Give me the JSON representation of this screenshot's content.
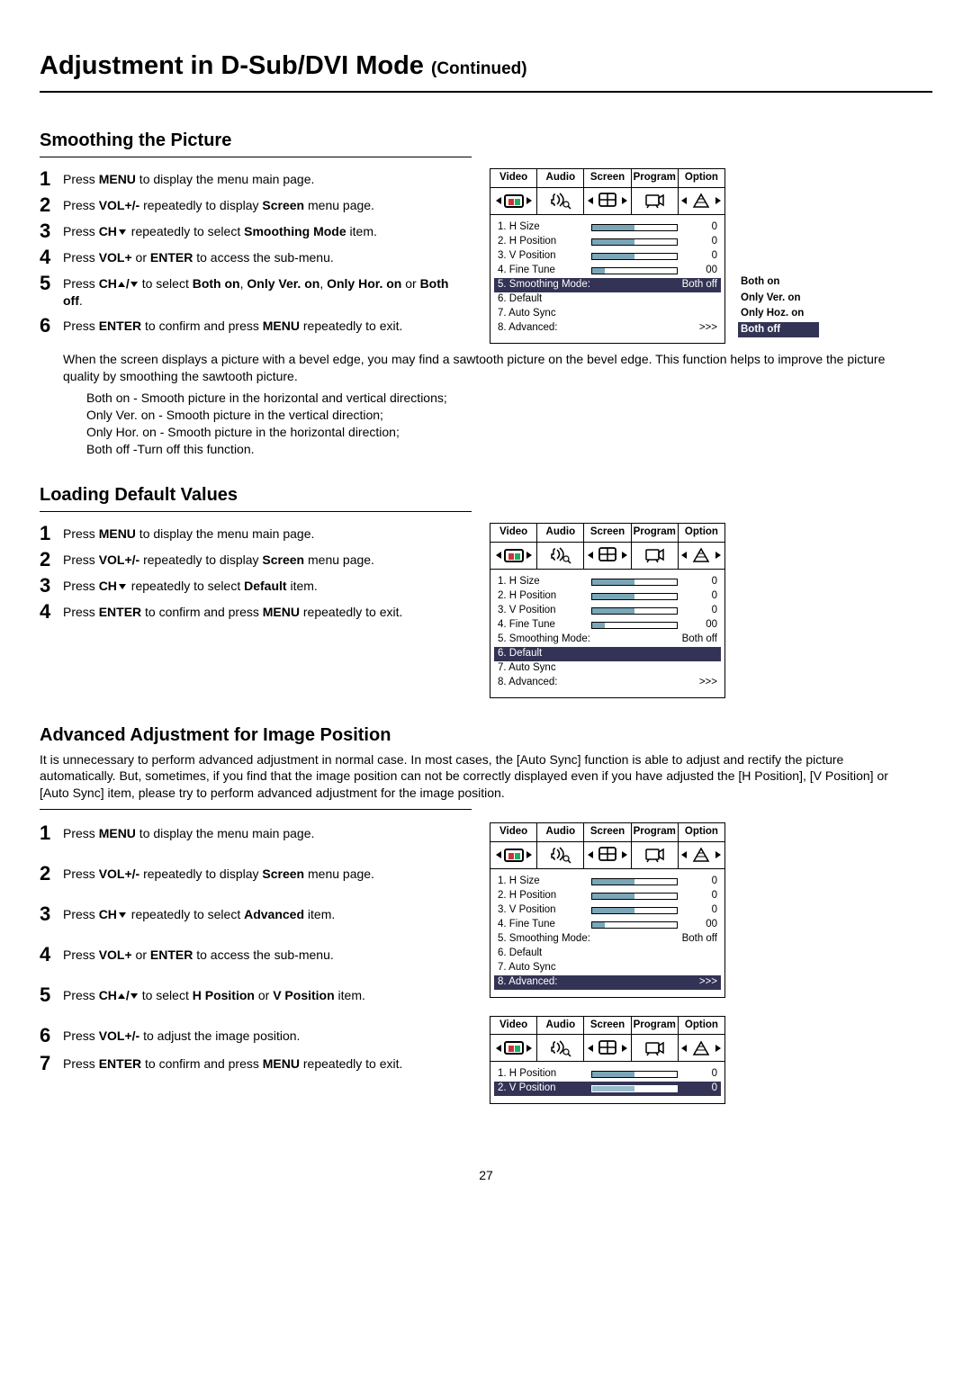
{
  "page": {
    "title": "Adjustment in D-Sub/DVI Mode ",
    "title_sub": "(Continued)",
    "number": "27"
  },
  "sections": {
    "smoothing": {
      "title": "Smoothing the Picture",
      "steps": {
        "s1a": "Press ",
        "s1b": "MENU",
        "s1c": " to display the menu main page.",
        "s2a": "Press ",
        "s2b": "VOL+/-",
        "s2c": " repeatedly to display ",
        "s2d": "Screen",
        "s2e": " menu page.",
        "s3a": "Press ",
        "s3b": "CH",
        "s3c": " repeatedly to select ",
        "s3d": "Smoothing Mode",
        "s3e": " item.",
        "s4a": "Press ",
        "s4b": "VOL+",
        "s4c": " or ",
        "s4d": "ENTER",
        "s4e": " to access the sub-menu.",
        "s5a": "Press ",
        "s5b": "CH",
        "s5c": " to select ",
        "s5d": "Both on",
        "s5e": ", ",
        "s5f": "Only Ver. on",
        "s5g": ", ",
        "s5h": "Only Hor. on",
        "s5i": " or ",
        "s5j": "Both off",
        "s5k": ".",
        "s6a": "Press ",
        "s6b": "ENTER",
        "s6c": " to confirm and press ",
        "s6d": "MENU",
        "s6e": " repeatedly to exit."
      },
      "explain1": "When the screen displays a picture with a bevel edge, you may find a sawtooth picture on the bevel edge. This function helps to improve the picture quality by smoothing the sawtooth picture.",
      "explain2a": "Both on - Smooth picture in the horizontal and vertical directions;",
      "explain2b": "Only Ver. on - Smooth picture in the vertical direction;",
      "explain2c": "Only Hor. on - Smooth picture in the horizontal direction;",
      "explain2d": "Both off -Turn off this function.",
      "sub_options": {
        "o1": "Both on",
        "o2": "Only Ver. on",
        "o3": "Only Hoz. on",
        "o4": "Both off"
      }
    },
    "default": {
      "title": "Loading Default Values",
      "steps": {
        "s1a": "Press ",
        "s1b": "MENU",
        "s1c": " to display the menu main page.",
        "s2a": "Press ",
        "s2b": "VOL+/-",
        "s2c": " repeatedly to display ",
        "s2d": "Screen",
        "s2e": " menu page.",
        "s3a": "Press ",
        "s3b": "CH",
        "s3c": " repeatedly to select ",
        "s3d": "Default",
        "s3e": " item.",
        "s4a": "Press ",
        "s4b": "ENTER",
        "s4c": " to confirm and press ",
        "s4d": "MENU",
        "s4e": " repeatedly to exit."
      }
    },
    "advanced": {
      "title": "Advanced Adjustment for Image Position",
      "intro": "It is unnecessary to perform advanced adjustment in normal case. In most cases, the [Auto Sync] function is able to adjust and rectify the picture automatically. But, sometimes, if you find that the image position can not be correctly displayed even if you have adjusted the [H Position], [V Position] or [Auto Sync] item, please try to perform advanced adjustment for the image position.",
      "steps": {
        "s1a": "Press ",
        "s1b": "MENU",
        "s1c": " to display the menu main page.",
        "s2a": "Press ",
        "s2b": "VOL+/-",
        "s2c": " repeatedly to display ",
        "s2d": "Screen",
        "s2e": " menu page.",
        "s3a": "Press ",
        "s3b": "CH",
        "s3c": " repeatedly to select ",
        "s3d": "Advanced",
        "s3e": " item.",
        "s4a": "Press ",
        "s4b": "VOL+",
        "s4c": " or ",
        "s4d": "ENTER",
        "s4e": " to access the sub-menu.",
        "s5a": "Press ",
        "s5b": "CH",
        "s5c": " to select ",
        "s5d": "H Position",
        "s5e": " or ",
        "s5f": "V Position",
        "s5g": " item.",
        "s6a": "Press ",
        "s6b": "VOL+/-",
        "s6c": " to adjust the image position.",
        "s7a": "Press ",
        "s7b": "ENTER",
        "s7c": " to confirm and press ",
        "s7d": "MENU",
        "s7e": " repeatedly to exit."
      }
    }
  },
  "osd": {
    "tabs": {
      "video": "Video",
      "audio": "Audio",
      "screen": "Screen",
      "program": "Program",
      "option": "Option"
    },
    "items": {
      "hsize": "1. H Size",
      "hpos": "2. H Position",
      "vpos": "3. V Position",
      "fine": "4. Fine Tune",
      "smooth": "5. Smoothing Mode:",
      "def": "6. Default",
      "auto": "7. Auto Sync",
      "adv": "8. Advanced:",
      "adv_h": "1. H Position",
      "adv_v": "2. V Position"
    },
    "vals": {
      "zero": "0",
      "dzero": "00",
      "bothoff": "Both off",
      "more": ">>>"
    }
  }
}
